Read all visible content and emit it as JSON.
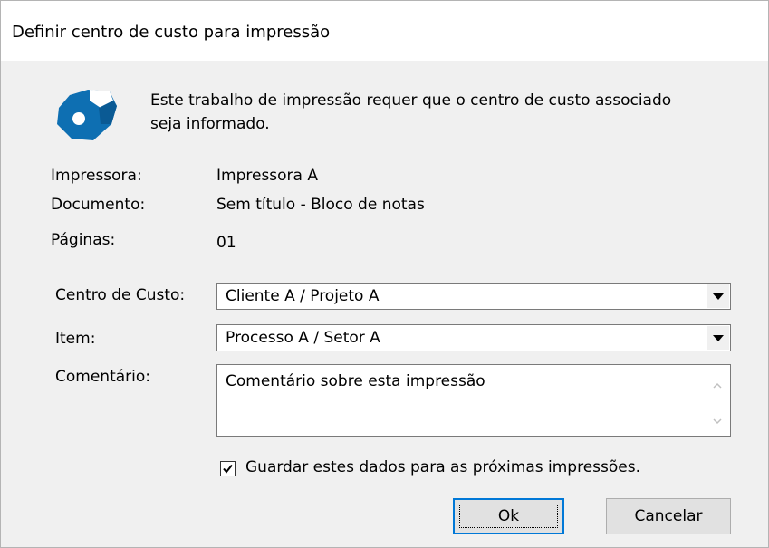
{
  "window": {
    "title": "Definir centro de custo para impressão"
  },
  "intro": {
    "text": "Este trabalho de impressão requer que o centro de custo associado seja informado."
  },
  "info": {
    "printer_label": "Impressora:",
    "printer_value": "Impressora A",
    "document_label": "Documento:",
    "document_value": "Sem título - Bloco de notas",
    "pages_label": "Páginas:",
    "pages_value": "01"
  },
  "form": {
    "cost_center_label": "Centro de Custo:",
    "cost_center_value": "Cliente A / Projeto A",
    "item_label": "Item:",
    "item_value": "Processo A / Setor A",
    "comment_label": "Comentário:",
    "comment_value": "Comentário sobre esta impressão",
    "save_checkbox_label": "Guardar estes dados para as próximas impressões.",
    "save_checkbox_checked": true
  },
  "buttons": {
    "ok": "Ok",
    "cancel": "Cancelar"
  },
  "colors": {
    "logo": "#0e6fb2",
    "focus_border": "#0078d7"
  }
}
